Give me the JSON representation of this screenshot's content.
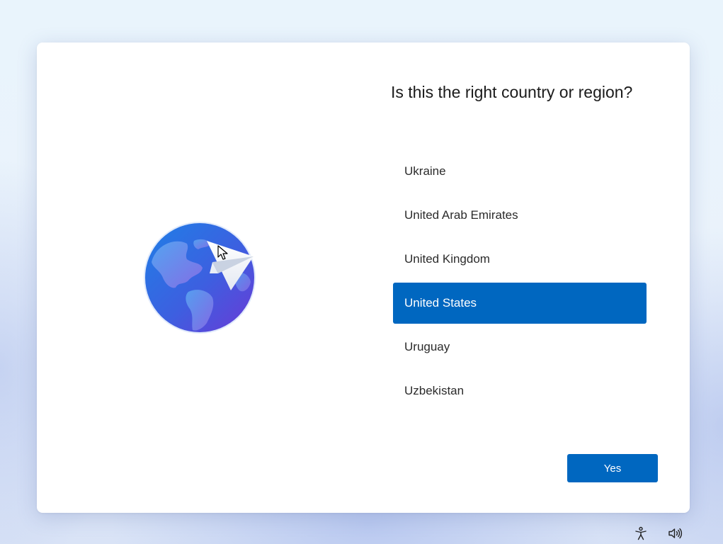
{
  "dialog": {
    "title": "Is this the right country or region?",
    "countries": [
      {
        "label": "Ukraine",
        "selected": false
      },
      {
        "label": "United Arab Emirates",
        "selected": false
      },
      {
        "label": "United Kingdom",
        "selected": false
      },
      {
        "label": "United States",
        "selected": true
      },
      {
        "label": "Uruguay",
        "selected": false
      },
      {
        "label": "Uzbekistan",
        "selected": false
      }
    ],
    "yes_label": "Yes"
  },
  "tray": {
    "icons": [
      "accessibility-icon",
      "volume-icon"
    ]
  },
  "colors": {
    "accent": "#0067c0",
    "card": "#ffffff",
    "text": "#1b1b1b"
  }
}
